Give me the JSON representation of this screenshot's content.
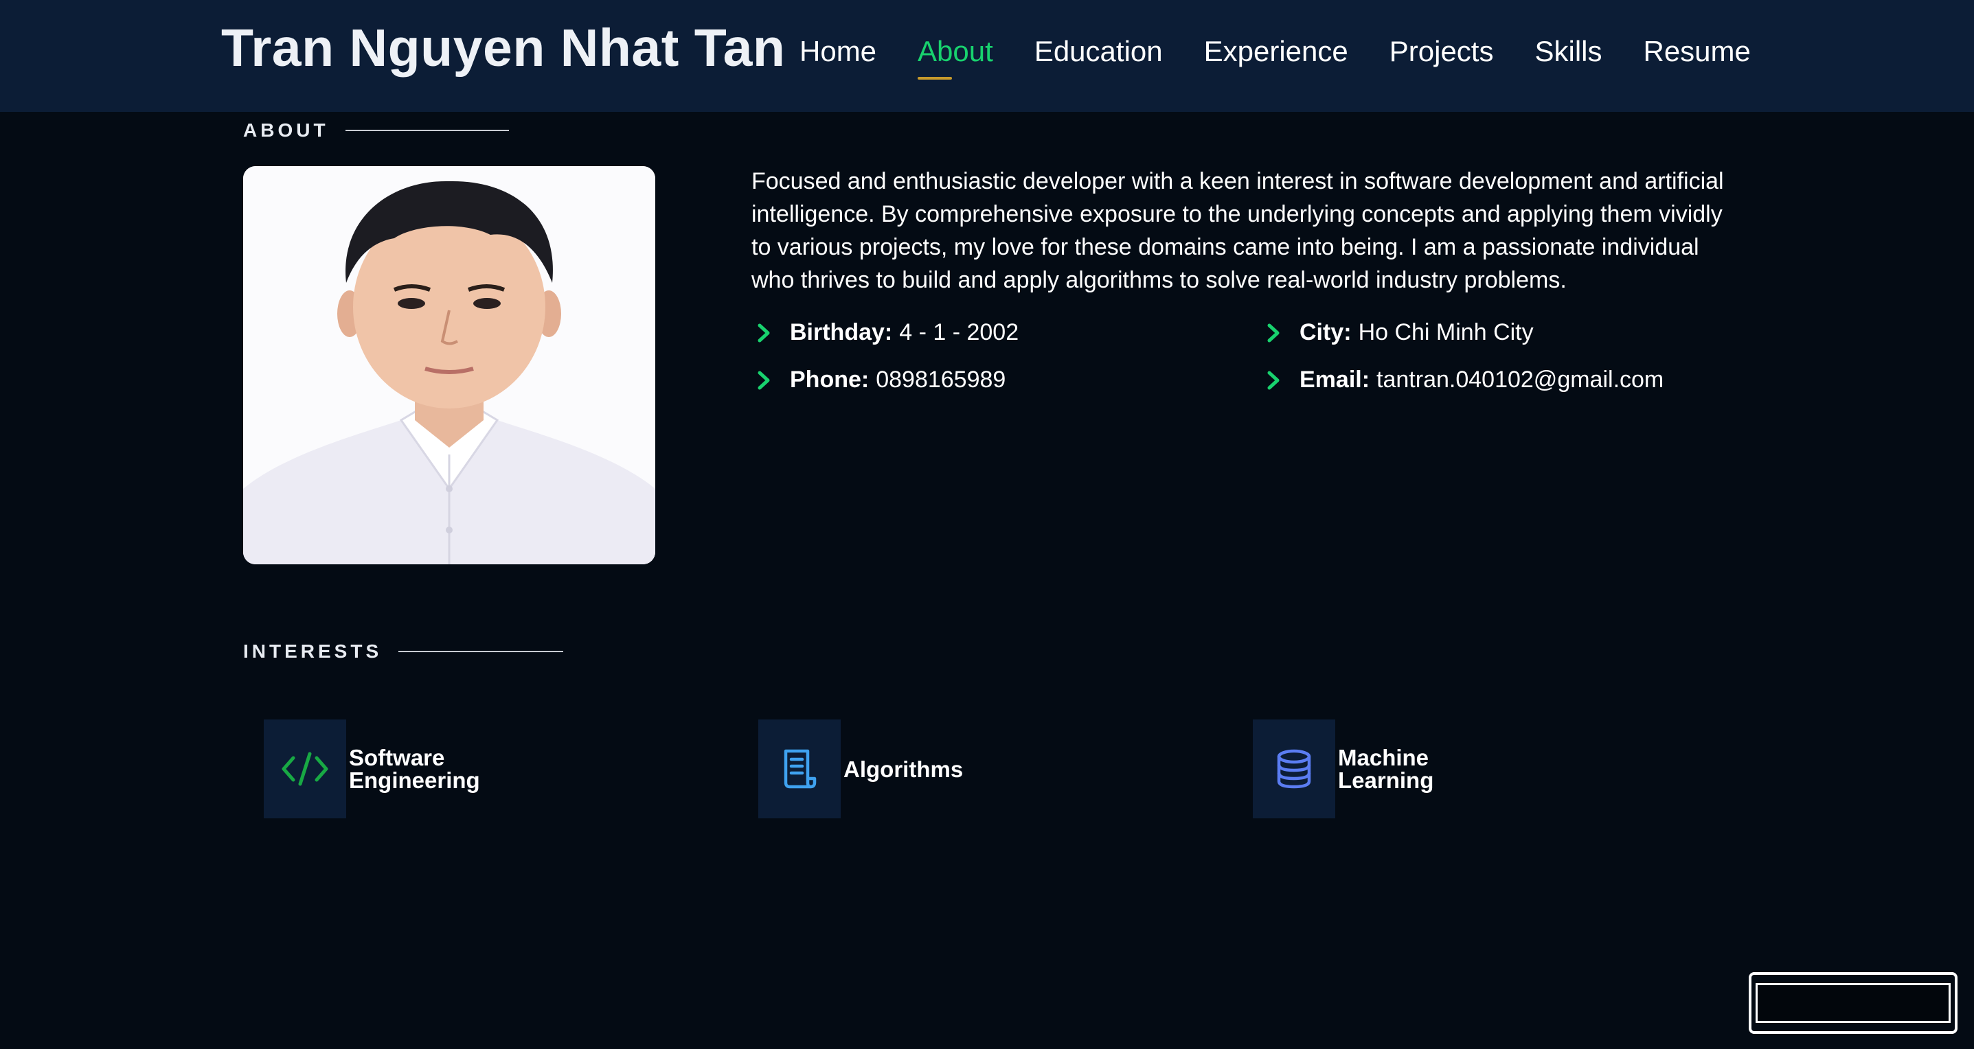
{
  "header": {
    "brand": "Tran Nguyen Nhat Tan",
    "nav": [
      {
        "label": "Home",
        "active": false
      },
      {
        "label": "About",
        "active": true
      },
      {
        "label": "Education",
        "active": false
      },
      {
        "label": "Experience",
        "active": false
      },
      {
        "label": "Projects",
        "active": false
      },
      {
        "label": "Skills",
        "active": false
      },
      {
        "label": "Resume",
        "active": false
      }
    ]
  },
  "about": {
    "title": "ABOUT",
    "bio": "Focused and enthusiastic developer with a keen interest in software development and artificial intelligence. By comprehensive exposure to the underlying concepts and applying them vividly to various projects, my love for these domains came into being. I am a passionate individual who thrives to build and apply algorithms to solve real-world industry problems.",
    "info": {
      "birthday": {
        "label": "Birthday:",
        "value": "4 - 1 - 2002"
      },
      "city": {
        "label": "City:",
        "value": "Ho Chi Minh City"
      },
      "phone": {
        "label": "Phone:",
        "value": "0898165989"
      },
      "email": {
        "label": "Email:",
        "value": "tantran.040102@gmail.com"
      }
    }
  },
  "interests": {
    "title": "INTERESTS",
    "items": [
      {
        "label": "Software Engineering",
        "icon": "code-icon",
        "color": "#18a944"
      },
      {
        "label": "Algorithms",
        "icon": "document-icon",
        "color": "#3fa2f0"
      },
      {
        "label": "Machine Learning",
        "icon": "database-icon",
        "color": "#5b7df2"
      }
    ]
  },
  "colors": {
    "accent": "#18d26e",
    "header_bg": "#0c1d36",
    "page_bg": "#040b14",
    "nav_underline": "#c79a2c"
  }
}
